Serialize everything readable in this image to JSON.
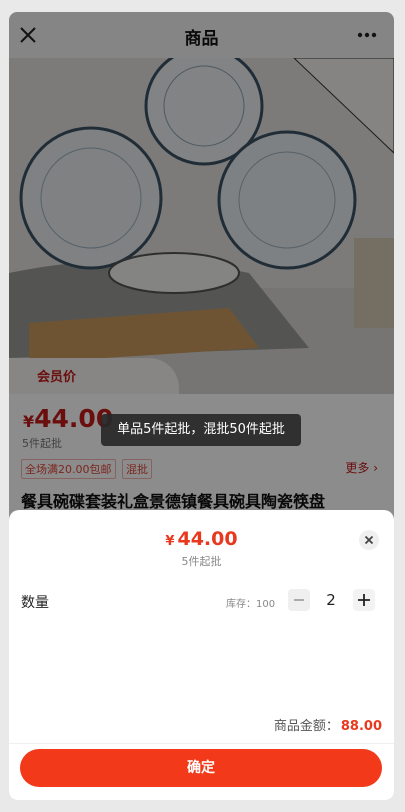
{
  "header": {
    "title": "商品"
  },
  "product": {
    "member_label": "会员价",
    "price_symbol": "¥",
    "price_value": "44.00",
    "min_note": "5件起批",
    "tags": [
      "全场满20.00包邮",
      "混批"
    ],
    "more_label": "更多 ›",
    "title": "餐具碗碟套装礼盒景德镇餐具碗具陶瓷筷盘"
  },
  "toast": {
    "text": "单品5件起批，混批50件起批"
  },
  "sheet": {
    "price_symbol": "¥",
    "price_value": "44.00",
    "min_qty": "5件起批",
    "qty_label": "数量",
    "stock_text": "库存：100",
    "qty_value": "2",
    "amount_label": "商品金额：",
    "amount_value": "88.00",
    "confirm_label": "确定"
  },
  "colors": {
    "accent": "#f23a1a",
    "price_red": "#c21b1b"
  }
}
